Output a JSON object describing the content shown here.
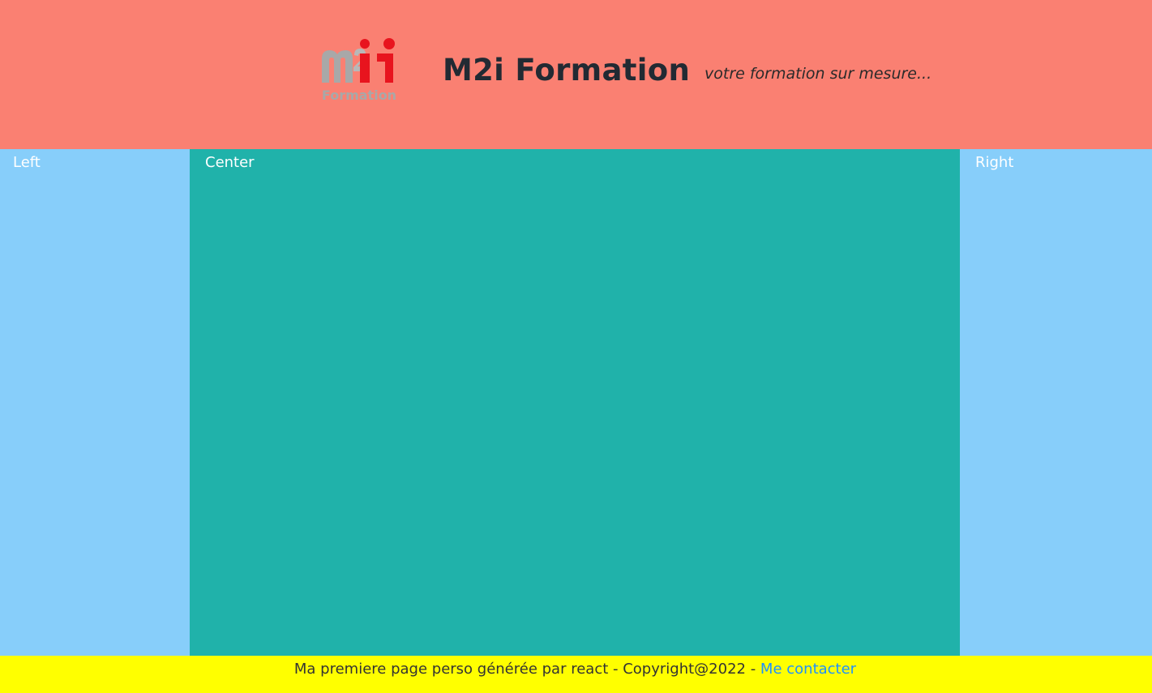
{
  "header": {
    "logo_text": "M2i Formation",
    "title": "M2i Formation",
    "tagline": "votre formation sur mesure..."
  },
  "columns": {
    "left": "Left",
    "center": "Center",
    "right": "Right"
  },
  "footer": {
    "text": "Ma premiere page perso générée par react - Copyright@2022 - ",
    "contact_link": "Me contacter"
  },
  "colors": {
    "header_bg": "#fa8072",
    "side_bg": "#87cefa",
    "center_bg": "#20b2aa",
    "footer_bg": "#ffff00",
    "link": "#1e90ff"
  }
}
